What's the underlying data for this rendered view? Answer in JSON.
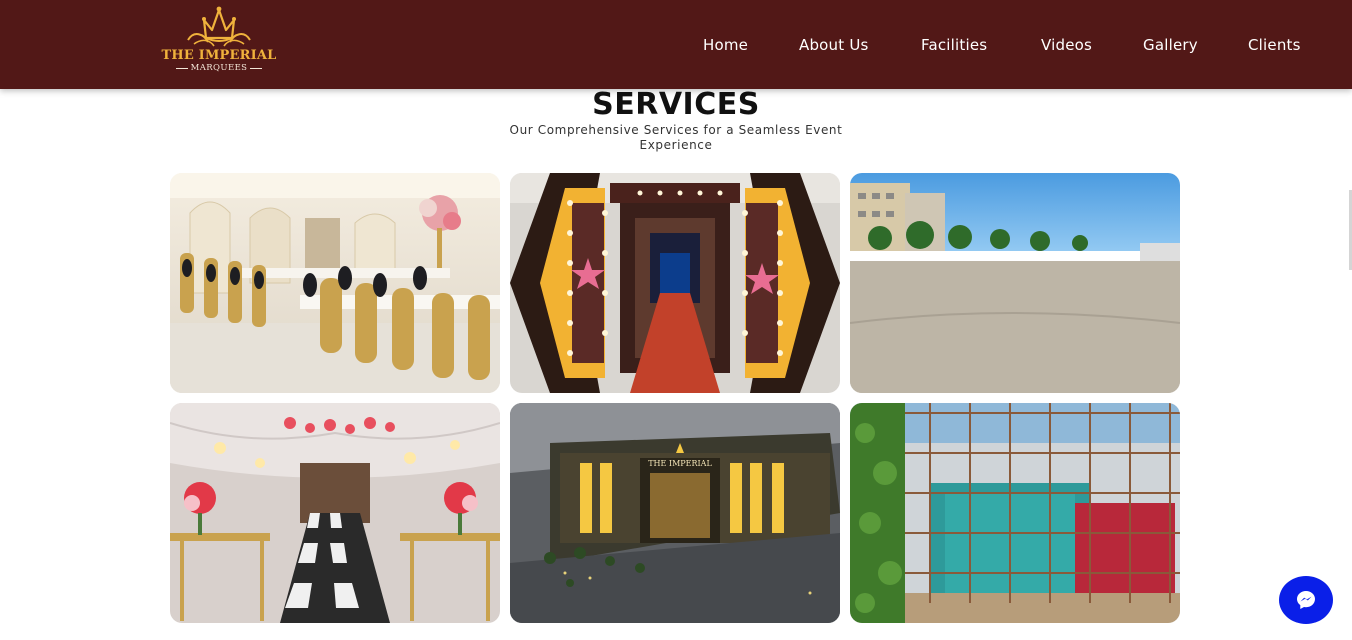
{
  "brand": {
    "name": "THE IMPERIAL",
    "tagline": "MARQUEES"
  },
  "nav": {
    "items": [
      {
        "label": "Home"
      },
      {
        "label": "About Us"
      },
      {
        "label": "Facilities"
      },
      {
        "label": "Videos"
      },
      {
        "label": "Gallery"
      },
      {
        "label": "Clients"
      }
    ]
  },
  "services": {
    "title": "SERVICES",
    "subtitle": "Our Comprehensive Services for a Seamless Event Experience",
    "signage_text": "THE IMPERIAL"
  },
  "icons": {
    "logo": "crown-icon",
    "chat": "messenger-icon"
  },
  "colors": {
    "navbar": "#521817",
    "logo_gold": "#f0b23c",
    "chat_button": "#0a1fe8"
  }
}
